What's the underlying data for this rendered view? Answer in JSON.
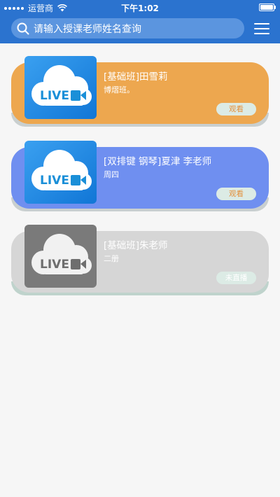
{
  "status_bar": {
    "carrier": "运营商",
    "time": "下午1:02"
  },
  "header": {
    "search_placeholder": "请输入授课老师姓名查询",
    "search_icon": "search-icon",
    "menu_icon": "hamburger-menu-icon"
  },
  "thumbnail_text": "LIVE",
  "colors": {
    "header_blue": "#2b73cf",
    "card_orange": "#eda74f",
    "card_blue": "#6f8ff0",
    "card_gray": "#d6d6d6"
  },
  "courses": [
    {
      "title": "[基础班]田雪莉",
      "subtitle": "博熠班。",
      "action": "观看",
      "status": "active"
    },
    {
      "title": "[双排键 钢琴]夏津 李老师",
      "subtitle": "周四",
      "action": "观看",
      "status": "active"
    },
    {
      "title": "[基础班]朱老师",
      "subtitle": "二册",
      "action": "未直播",
      "status": "inactive"
    }
  ]
}
